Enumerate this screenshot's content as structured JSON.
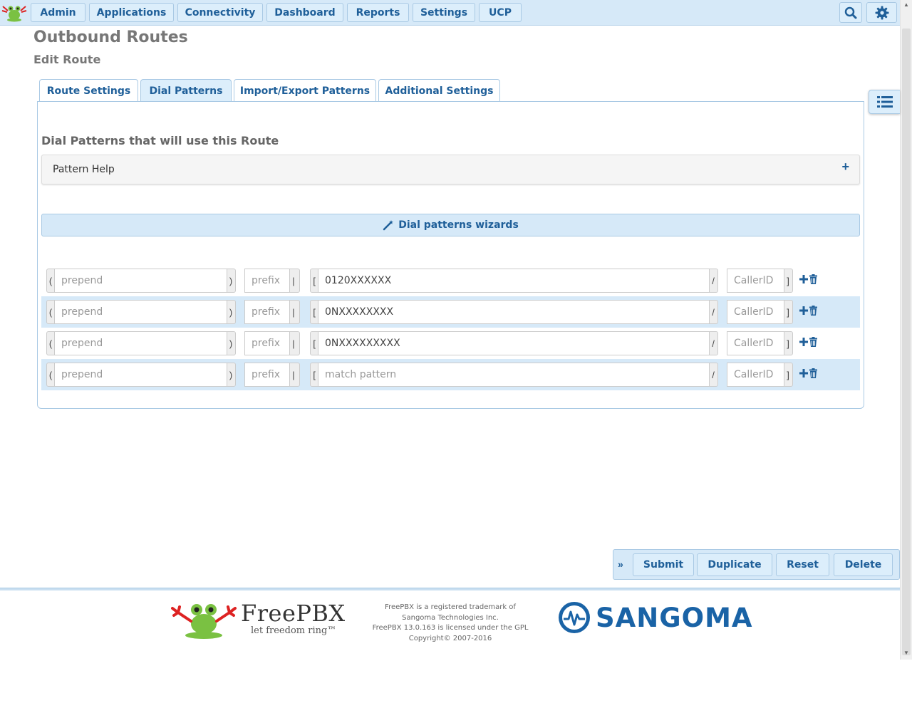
{
  "nav": {
    "items": [
      "Admin",
      "Applications",
      "Connectivity",
      "Dashboard",
      "Reports",
      "Settings",
      "UCP"
    ],
    "search_icon": "search-icon",
    "settings_icon": "gear-icon"
  },
  "page": {
    "title": "Outbound Routes",
    "subtitle": "Edit Route"
  },
  "tabs": [
    {
      "label": "Route Settings",
      "active": false
    },
    {
      "label": "Dial Patterns",
      "active": true
    },
    {
      "label": "Import/Export Patterns",
      "active": false
    },
    {
      "label": "Additional Settings",
      "active": false
    }
  ],
  "dial_patterns": {
    "heading": "Dial Patterns that will use this Route",
    "help_label": "Pattern Help",
    "wizard_label": "Dial patterns wizards",
    "placeholders": {
      "prepend": "prepend",
      "prefix": "prefix",
      "match": "match pattern",
      "callerid": "CallerID"
    },
    "addons": {
      "open_paren": "(",
      "close_paren": ")",
      "pipe": "|",
      "open_bracket": "[",
      "slash": "/",
      "close_bracket": "]"
    },
    "rows": [
      {
        "prepend": "",
        "prefix": "",
        "match": "0120XXXXXX",
        "callerid": ""
      },
      {
        "prepend": "",
        "prefix": "",
        "match": "0NXXXXXXXX",
        "callerid": ""
      },
      {
        "prepend": "",
        "prefix": "",
        "match": "0NXXXXXXXXX",
        "callerid": ""
      },
      {
        "prepend": "",
        "prefix": "",
        "match": "",
        "callerid": ""
      }
    ]
  },
  "actions": {
    "submit": "Submit",
    "duplicate": "Duplicate",
    "reset": "Reset",
    "delete": "Delete",
    "collapse_glyph": "»"
  },
  "footer": {
    "line1": "FreePBX is a registered trademark of",
    "line2": "Sangoma Technologies Inc.",
    "line3": "FreePBX 13.0.163 is licensed under the GPL",
    "line4": "Copyright© 2007-2016",
    "freepbx_name": "FreePBX",
    "freepbx_tagline": "let freedom ring™",
    "sangoma_name": "SANGOMA"
  },
  "colors": {
    "accent": "#1f5f99",
    "bar_bg": "#d6e9f8",
    "border": "#a9c9e4",
    "brand_sangoma": "#1a63a6"
  }
}
